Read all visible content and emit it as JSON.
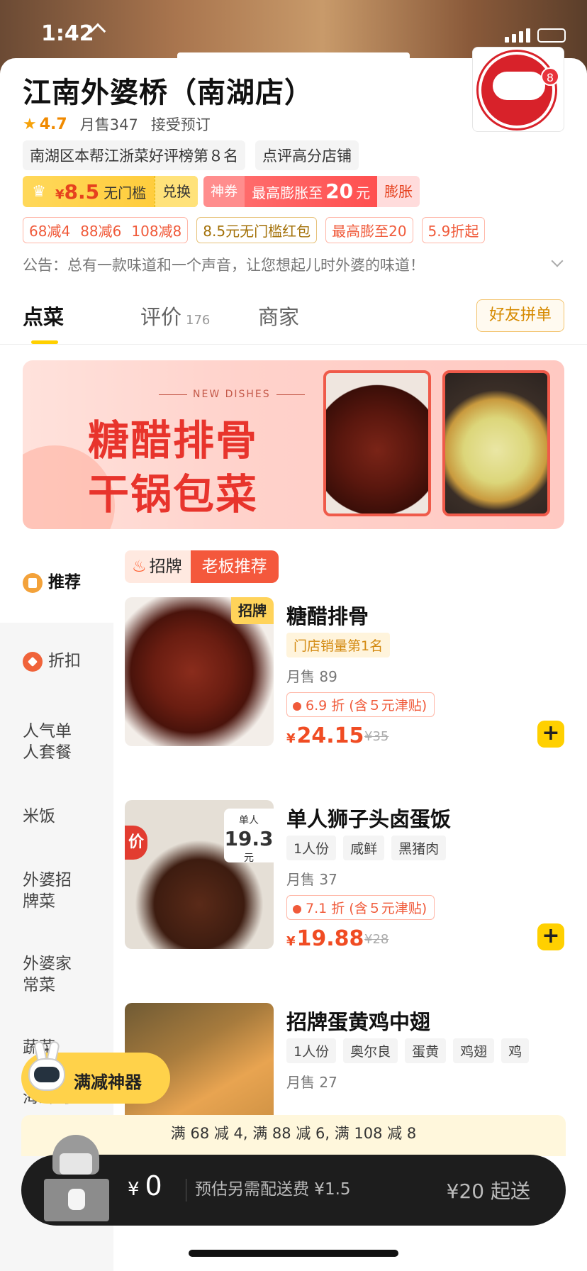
{
  "status_bar": {
    "time": "1:42"
  },
  "shop": {
    "name": "江南外婆桥（南湖店）",
    "rating": "4.7",
    "monthly_sales": "月售347",
    "reservation": "接受预订",
    "tags": [
      "南湖区本帮江浙菜好评榜第８名",
      "点评高分店铺"
    ],
    "logo_badge": "8",
    "coupon_vip": {
      "amount": "8.5",
      "currency": "¥",
      "desc": "无门槛",
      "action": "兑换"
    },
    "coupon_god": {
      "label": "神券",
      "prefix": "最高膨胀至",
      "amount": "20",
      "unit": "元",
      "action": "膨胀"
    },
    "promos": [
      {
        "items": [
          "68减4",
          "88减6",
          "108减8"
        ],
        "style": "red"
      },
      {
        "items": [
          "8.5元无门槛红包"
        ],
        "style": "gold"
      },
      {
        "items": [
          "最高膨至20"
        ],
        "style": "red"
      },
      {
        "items": [
          "5.9折起"
        ],
        "style": "red"
      }
    ],
    "notice": "公告：总有一款味道和一个声音，让您想起儿时外婆的味道！"
  },
  "tabs": [
    {
      "label": "点菜",
      "count": ""
    },
    {
      "label": "评价",
      "count": "176"
    },
    {
      "label": "商家",
      "count": ""
    }
  ],
  "share_button": "好友拼单",
  "banner": {
    "subtitle": "NEW DISHES",
    "line1": "糖醋排骨",
    "line2": "干锅包菜"
  },
  "side_nav": [
    {
      "label": "推荐",
      "icon": "recommend-icon"
    },
    {
      "label": "折扣",
      "icon": "discount-icon"
    },
    {
      "label": "人气单\n人套餐"
    },
    {
      "label": "米饭"
    },
    {
      "label": "外婆招\n牌菜"
    },
    {
      "label": "外婆家\n常菜"
    },
    {
      "label": "蔬菜"
    },
    {
      "label": "海鲜河"
    }
  ],
  "category_header": {
    "tag": "招牌",
    "title": "老板推荐"
  },
  "dishes": [
    {
      "name": "糖醋排骨",
      "img_flag": "招牌",
      "rank": "门店销量第1名",
      "chips": [],
      "sold": "月售 89",
      "discount": "6.9 折 (含５元津贴)",
      "price": "24.15",
      "orig_price": "¥35"
    },
    {
      "name": "单人狮子头卤蛋饭",
      "img_special": "特价",
      "img_tag_top": "单人",
      "img_tag_price": "19.3",
      "img_tag_unit": "元",
      "rank": "",
      "chips": [
        "1人份",
        "咸鲜",
        "黑猪肉"
      ],
      "sold": "月售 37",
      "discount": "7.1 折 (含５元津贴)",
      "price": "19.88",
      "orig_price": "¥28"
    },
    {
      "name": "招牌蛋黄鸡中翅",
      "rank": "",
      "chips": [
        "1人份",
        "奥尔良",
        "蛋黄",
        "鸡翅",
        "鸡"
      ],
      "sold": "月售 27"
    }
  ],
  "floating": {
    "label": "满减神器"
  },
  "promo_strip": "满 68 减 4, 满 88 减 6, 满 108 减 8",
  "cart": {
    "currency": "¥",
    "total": "0",
    "delivery_fee": "预估另需配送费 ¥1.5",
    "min_order": "¥20 起送"
  },
  "colors": {
    "accent_yellow": "#ffd000",
    "price_red": "#f04c23",
    "brand_red": "#e8342c"
  }
}
